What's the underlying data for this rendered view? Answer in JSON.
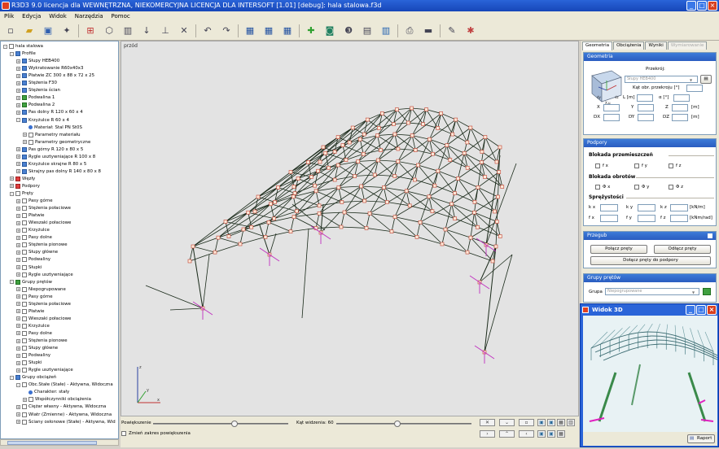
{
  "window": {
    "title": "R3D3 9.0 licencja dla WEWNĘTRZNA, NIEKOMERCYJNA LICENCJA DLA INTERSOFT [1.01] [debug]: hala stalowa.f3d",
    "buttons": [
      "_",
      "□",
      "×"
    ]
  },
  "menu": [
    "Plik",
    "Edycja",
    "Widok",
    "Narzędzia",
    "Pomoc"
  ],
  "toolbar_icons": [
    "new-icon",
    "open-icon",
    "save-icon",
    "wizard-icon",
    "frame-icon",
    "nodes-icon",
    "bars-icon",
    "loads-icon",
    "supports-icon",
    "delete-icon",
    "undo-icon",
    "redo-icon",
    "grid-a-icon",
    "grid-b-icon",
    "grid-c-icon",
    "calculate-icon",
    "results-icon",
    "3d-icon",
    "render-icon",
    "table-icon",
    "print-icon",
    "export-icon",
    "settings-icon",
    "help-icon"
  ],
  "tree": {
    "items": [
      {
        "label": "hala stalowa",
        "level": 0,
        "pm": "-",
        "icon": "project"
      },
      {
        "label": "Profile",
        "level": 1,
        "pm": "-",
        "icon": "blue"
      },
      {
        "label": "Słupy HEB400",
        "level": 2,
        "pm": "+",
        "icon": "blue"
      },
      {
        "label": "Wykratowanie R60x40x3",
        "level": 2,
        "pm": "+",
        "icon": "blue"
      },
      {
        "label": "Płatwie ZC 300 x 88 x 72 x 25",
        "level": 2,
        "pm": "+",
        "icon": "blue"
      },
      {
        "label": "Stężenia F30",
        "level": 2,
        "pm": "+",
        "icon": "blue"
      },
      {
        "label": "Stężenia ścian",
        "level": 2,
        "pm": "+",
        "icon": "blue"
      },
      {
        "label": "Podwalina 1",
        "level": 2,
        "pm": "+",
        "icon": "green"
      },
      {
        "label": "Podwalina 2",
        "level": 2,
        "pm": "+",
        "icon": "green"
      },
      {
        "label": "Pas dolny R 120 x 60 x 4",
        "level": 2,
        "pm": "+",
        "icon": "blue"
      },
      {
        "label": "Krzyżulce R 60 x 4",
        "level": 2,
        "pm": "-",
        "icon": "blue"
      },
      {
        "label": "Materiał: Stal PN St0S",
        "level": 3,
        "pm": "",
        "icon": "dot"
      },
      {
        "label": "Parametry materiału",
        "level": 3,
        "pm": "+",
        "icon": ""
      },
      {
        "label": "Parametry geometryczne",
        "level": 3,
        "pm": "+",
        "icon": ""
      },
      {
        "label": "Pas górny R 120 x 80 x 5",
        "level": 2,
        "pm": "+",
        "icon": "blue"
      },
      {
        "label": "Rygle usztywniające R 100 x 8",
        "level": 2,
        "pm": "+",
        "icon": "blue"
      },
      {
        "label": "Krzyżulce skrajne R 80 x 5",
        "level": 2,
        "pm": "+",
        "icon": "blue"
      },
      {
        "label": "Skrajny pas dolny R 140 x 80 x 8",
        "level": 2,
        "pm": "+",
        "icon": "blue"
      },
      {
        "label": "Węzły",
        "level": 1,
        "pm": "+",
        "icon": "red"
      },
      {
        "label": "Podpory",
        "level": 1,
        "pm": "+",
        "icon": "red"
      },
      {
        "label": "Pręty",
        "level": 1,
        "pm": "-",
        "icon": ""
      },
      {
        "label": "Pasy górne",
        "level": 2,
        "pm": "+",
        "icon": ""
      },
      {
        "label": "Stężenia połaciowe",
        "level": 2,
        "pm": "+",
        "icon": ""
      },
      {
        "label": "Płatwie",
        "level": 2,
        "pm": "+",
        "icon": ""
      },
      {
        "label": "Wieszaki połaciowe",
        "level": 2,
        "pm": "+",
        "icon": ""
      },
      {
        "label": "Krzyżulce",
        "level": 2,
        "pm": "+",
        "icon": ""
      },
      {
        "label": "Pasy dolne",
        "level": 2,
        "pm": "+",
        "icon": ""
      },
      {
        "label": "Stężenia pionowe",
        "level": 2,
        "pm": "+",
        "icon": ""
      },
      {
        "label": "Słupy główne",
        "level": 2,
        "pm": "+",
        "icon": ""
      },
      {
        "label": "Podwaliny",
        "level": 2,
        "pm": "+",
        "icon": ""
      },
      {
        "label": "Słupki",
        "level": 2,
        "pm": "+",
        "icon": ""
      },
      {
        "label": "Rygle usztywniające",
        "level": 2,
        "pm": "+",
        "icon": ""
      },
      {
        "label": "Grupy prętów",
        "level": 1,
        "pm": "-",
        "icon": "green"
      },
      {
        "label": "Niepogrupowane",
        "level": 2,
        "pm": "+",
        "icon": ""
      },
      {
        "label": "Pasy górne",
        "level": 2,
        "pm": "+",
        "icon": ""
      },
      {
        "label": "Stężenia połaciowe",
        "level": 2,
        "pm": "+",
        "icon": ""
      },
      {
        "label": "Płatwie",
        "level": 2,
        "pm": "+",
        "icon": ""
      },
      {
        "label": "Wieszaki połaciowe",
        "level": 2,
        "pm": "+",
        "icon": ""
      },
      {
        "label": "Krzyżulce",
        "level": 2,
        "pm": "+",
        "icon": ""
      },
      {
        "label": "Pasy dolne",
        "level": 2,
        "pm": "+",
        "icon": ""
      },
      {
        "label": "Stężenia pionowe",
        "level": 2,
        "pm": "+",
        "icon": ""
      },
      {
        "label": "Słupy główne",
        "level": 2,
        "pm": "+",
        "icon": ""
      },
      {
        "label": "Podwaliny",
        "level": 2,
        "pm": "+",
        "icon": ""
      },
      {
        "label": "Słupki",
        "level": 2,
        "pm": "+",
        "icon": ""
      },
      {
        "label": "Rygle usztywniające",
        "level": 2,
        "pm": "+",
        "icon": ""
      },
      {
        "label": "Grupy obciążeń",
        "level": 1,
        "pm": "-",
        "icon": "blue"
      },
      {
        "label": "Obc.Stałe (Stałe) - Aktywna, Widoczna",
        "level": 2,
        "pm": "-",
        "icon": ""
      },
      {
        "label": "Charakter: stały",
        "level": 3,
        "pm": "",
        "icon": "dot"
      },
      {
        "label": "Współczynniki obciążenia",
        "level": 3,
        "pm": "+",
        "icon": ""
      },
      {
        "label": "Ciężar własny - Aktywna, Widoczna",
        "level": 2,
        "pm": "+",
        "icon": ""
      },
      {
        "label": "Wiatr (Zmienne) - Aktywna, Widoczna",
        "level": 2,
        "pm": "+",
        "icon": ""
      },
      {
        "label": "Ściany osłonowe (Stałe) - Aktywna, Wid",
        "level": 2,
        "pm": "+",
        "icon": ""
      }
    ]
  },
  "viewport": {
    "label": "przód",
    "axes": [
      "x",
      "y",
      "z"
    ]
  },
  "bottom": {
    "zoom_label": "Powiększenie",
    "angle_label": "Kąt widzenia: 60",
    "reduce_label": "Zmień zakres powiększenia",
    "zoom_level": 0.61,
    "angle_level": 0.45
  },
  "right": {
    "tabs": [
      {
        "label": "Geometria",
        "state": "active"
      },
      {
        "label": "Obciążenia",
        "state": "normal"
      },
      {
        "label": "Wyniki",
        "state": "normal"
      },
      {
        "label": "Wymiarowanie",
        "state": "disabled"
      }
    ],
    "geometry": {
      "header": "Geometria",
      "section_label": "Przekrój:",
      "section_value": "Słupy HEB400",
      "angle_label": "Kąt obr. przekroju [°]",
      "L_label": "L [m]",
      "alpha_label": "α [°]",
      "coords": [
        {
          "a": "X",
          "b": "Y",
          "c": "Z",
          "unit": "[m]"
        },
        {
          "a": "DX",
          "b": "DY",
          "c": "DZ",
          "unit": "[m]"
        }
      ],
      "preview_labels": [
        "dy",
        "dz",
        "X,μ"
      ]
    },
    "supports": {
      "header": "Podpory",
      "translation_title": "Blokada przemieszczeń",
      "translation_items": [
        "f x",
        "f y",
        "f z"
      ],
      "rotation_title": "Blokada obrotów",
      "rotation_items": [
        "Φ x",
        "Φ y",
        "Φ z"
      ],
      "springs_title": "Sprężystości",
      "spring_rows": [
        {
          "labels": [
            "k x",
            "k y",
            "k z"
          ],
          "unit": "[kN/m]"
        },
        {
          "labels": [
            "f x",
            "f y",
            "f z"
          ],
          "unit": "[kNm/rad]"
        }
      ]
    },
    "joint": {
      "header": "Przegub",
      "connect": "Połącz pręty",
      "disconnect": "Odłącz pręty",
      "attach": "Dołącz pręty do podpory"
    },
    "groups": {
      "header": "Grupy prętów",
      "group_label": "Grupa",
      "group_value": "Niepogrupowane"
    }
  },
  "widok3d": {
    "title": "Widok 3D",
    "report": "Raport"
  }
}
